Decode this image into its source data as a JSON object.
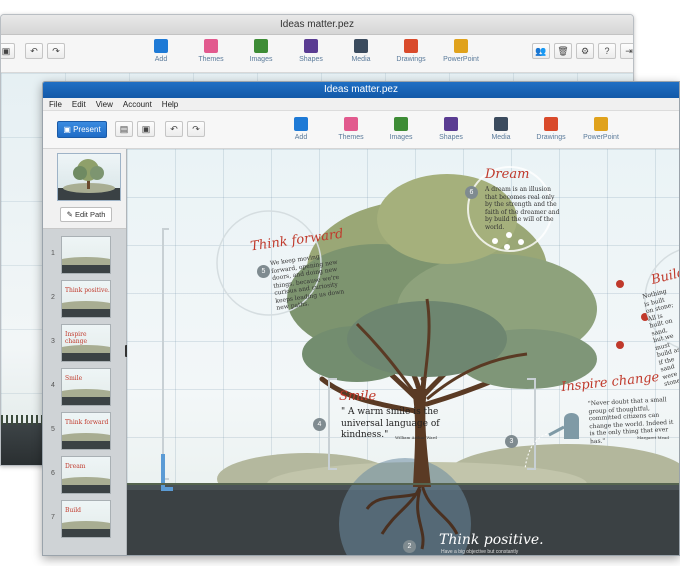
{
  "back_window": {
    "title": "Ideas matter.pez",
    "insert_items": [
      {
        "label": "Add",
        "color": "#1e7ad6"
      },
      {
        "label": "Themes",
        "color": "#e25a8e"
      },
      {
        "label": "Images",
        "color": "#3e8c36"
      },
      {
        "label": "Shapes",
        "color": "#5a3c92"
      },
      {
        "label": "Media",
        "color": "#3b4b5e"
      },
      {
        "label": "Drawings",
        "color": "#d94a2b"
      },
      {
        "label": "PowerPoint",
        "color": "#e0a21c"
      }
    ]
  },
  "front_window": {
    "title": "Ideas matter.pez",
    "menu": [
      "File",
      "Edit",
      "View",
      "Account",
      "Help"
    ],
    "present_label": "Present",
    "insert_items": [
      {
        "label": "Add",
        "color": "#1e7ad6"
      },
      {
        "label": "Themes",
        "color": "#e25a8e"
      },
      {
        "label": "Images",
        "color": "#3e8c36"
      },
      {
        "label": "Shapes",
        "color": "#5a3c92"
      },
      {
        "label": "Media",
        "color": "#3b4b5e"
      },
      {
        "label": "Drawings",
        "color": "#d94a2b"
      },
      {
        "label": "PowerPoint",
        "color": "#e0a21c"
      }
    ],
    "edit_path_label": "Edit Path",
    "slides": [
      {
        "num": "1",
        "caption": ""
      },
      {
        "num": "2",
        "caption": "Think positive."
      },
      {
        "num": "3",
        "caption": "Inspire change"
      },
      {
        "num": "4",
        "caption": "Smile"
      },
      {
        "num": "5",
        "caption": "Think forward"
      },
      {
        "num": "6",
        "caption": "Dream"
      },
      {
        "num": "7",
        "caption": "Build"
      }
    ]
  },
  "canvas": {
    "dream": {
      "title": "Dream",
      "num": "6",
      "text": "A dream is an illusion that becomes real only by the strength and the faith of the dreamer and by build the will of the world."
    },
    "think_forward": {
      "title": "Think forward",
      "num": "5",
      "text": "We keep moving forward, opening new doors, and doing new things, because we're curious and curiosity keeps leading us down new paths."
    },
    "build": {
      "title": "Build",
      "text": "Nothing is built on stone; All is built on sand, but we must build as if the sand were stone."
    },
    "smile": {
      "title": "Smile",
      "num": "4",
      "text": "\" A warm smile is the universal language of kindness.\"",
      "author": "William Arthur Ward"
    },
    "inspire": {
      "title": "Inspire change",
      "num": "3",
      "text": "\"Never doubt that a small group of thoughtful, committed citizens can change the world. Indeed it is the only thing that ever has.\"",
      "author": "Margaret Mead"
    },
    "think_positive": {
      "title": "Think positive.",
      "num": "2",
      "text": "Have a big objective but constantly"
    }
  }
}
